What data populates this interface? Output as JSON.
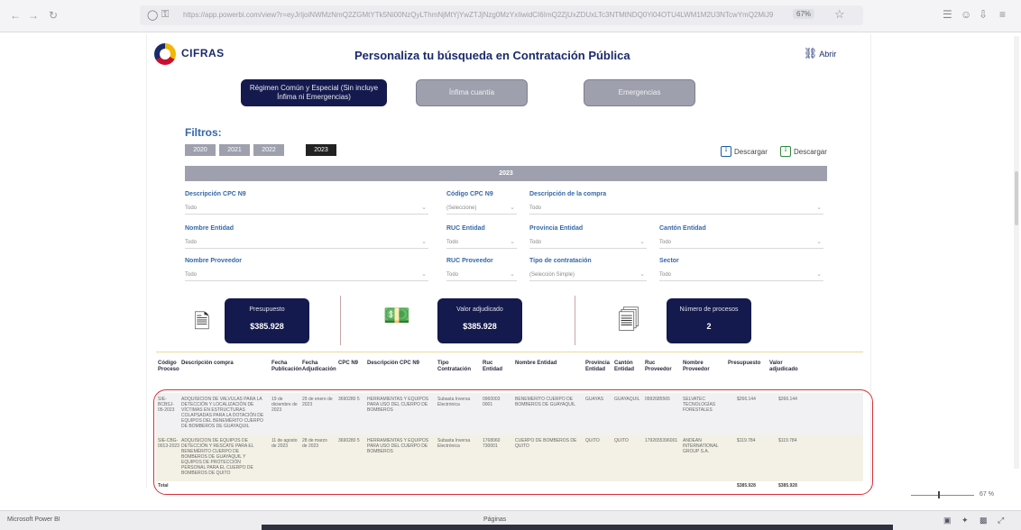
{
  "page": {
    "brand": "CIFRAS",
    "title": "Personaliza tu búsqueda en Contratación Pública",
    "open_label": "Abrir"
  },
  "tabs": [
    {
      "label": "Régimen Común y Especial (Sin incluye Ínfima ni Emergencias)"
    },
    {
      "label": "Ínfima cuantía"
    },
    {
      "label": "Emergencias"
    }
  ],
  "filters": {
    "heading": "Filtros:",
    "years": [
      "2020",
      "2021",
      "2022",
      "2023"
    ],
    "selected_year": "2023",
    "year_bar": "2023",
    "download_left": "Descargar",
    "download_right": "Descargar",
    "fields": [
      {
        "label": "Descripción CPC N9",
        "value": "Todo"
      },
      {
        "label": "Código CPC N9",
        "value": "(Seleccione)"
      },
      {
        "label": "Descripción de la compra",
        "value": "Todo"
      },
      {
        "label": "Nombre Entidad",
        "value": "Todo"
      },
      {
        "label": "RUC Entidad",
        "value": "Todo"
      },
      {
        "label": "Provincia Entidad",
        "value": "Todo"
      },
      {
        "label": "Cantón Entidad",
        "value": "Todo"
      },
      {
        "label": "Nombre Proveedor",
        "value": "Todo"
      },
      {
        "label": "RUC Proveedor",
        "value": "Todo"
      },
      {
        "label": "Tipo de contratación",
        "value": "(Selección Simple)"
      },
      {
        "label": "Sector",
        "value": "Todo"
      }
    ]
  },
  "kpis": [
    {
      "title": "Presupuesto",
      "value": "$385.928",
      "icon": "document-chart-icon"
    },
    {
      "title": "Valor adjudicado",
      "value": "$385.928",
      "icon": "money-icon"
    },
    {
      "title": "Número de procesos",
      "value": "2",
      "icon": "copy-document-icon"
    }
  ],
  "table": {
    "headers": [
      "Código Proceso",
      "Descripción compra",
      "Fecha Publicación",
      "Fecha Adjudicación",
      "CPC N9",
      "Descripción CPC N9",
      "Tipo Contratación",
      "Ruc Entidad",
      "Nombre Entidad",
      "Provincia Entidad",
      "Cantón Entidad",
      "Ruc Proveedor",
      "Nombre Proveedor",
      "Presupuesto",
      "Valor adjudicado"
    ],
    "rows": [
      [
        "SIE-BCBSJ-05-2023",
        "ADQUISICIÓN DE VALVULAS PARA LA DETECCIÓN Y LOCALIZACIÓN DE VÍCTIMAS EN ESTRUCTURAS COLAPSADAS PARA LA DOTACIÓN DE EQUIPOS DEL BENEMÉRITO CUERPO DE BOMBEROS DE GUAYAQUIL",
        "19 de diciembre de 2023",
        "29 de enero de 2023",
        "3690280 5",
        "HERRAMIENTAS Y EQUIPOS PARA USO DEL CUERPO DE BOMBEROS",
        "Subasta Inversa Electrónica",
        "0960003 0001",
        "BENEMÉRITO CUERPO DE BOMBEROS DE GUAYAQUIL",
        "GUAYAS",
        "GUAYAQUIL",
        "0992685565",
        "SELVATEC TECNOLOGÍAS FORESTALES",
        "$266.144",
        "$266.144"
      ],
      [
        "SIE-CBG-0013-2023",
        "ADQUISICIÓN DE EQUIPOS DE DETECCIÓN Y RESCATE PARA EL BENEMÉRITO CUERPO DE BOMBEROS DE GUAYAQUIL Y EQUIPOS DE PROTECCIÓN PERSONAL PARA EL CUERPO DE BOMBEROS DE QUITO",
        "11 de agosto de 2023",
        "28 de marzo de 2023",
        "3690280 5",
        "HERRAMIENTAS Y EQUIPOS PARA USO DEL CUERPO DE BOMBEROS",
        "Subasta Inversa Electrónica",
        "1768060 730001",
        "CUERPO DE BOMBEROS DE QUITO",
        "QUITO",
        "QUITO",
        "1792655396001",
        "ANDEAN INTERNATIONAL GROUP S.A.",
        "$119.784",
        "$119.784"
      ]
    ],
    "total_label": "Total",
    "total_presupuesto": "$385.928",
    "total_adjudicado": "$385.928"
  },
  "browser": {
    "url": "https://app.powerbi.com/view?r=eyJrIjoiNWMzNmQ2ZGMtYTk5Ni00NzQyLThmNjMtYjYwZTJjNzg0MzYxIiwidCI6ImQ2ZjUxZDUxLTc3NTMtNDQ0Yi04OTU4LWM1M2U3NTcwYmQ2MiJ9",
    "zoom": "67%"
  },
  "statusbar": {
    "left": "Microsoft Power BI",
    "middle": "Páginas",
    "zoom": "67 %"
  }
}
